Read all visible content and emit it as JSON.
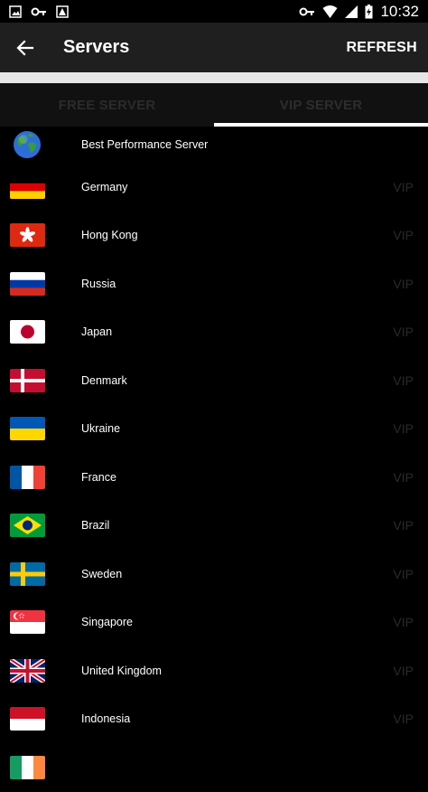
{
  "status_bar": {
    "time": "10:32"
  },
  "app_bar": {
    "title": "Servers",
    "refresh_label": "REFRESH"
  },
  "tabs": [
    {
      "label": "FREE SERVER",
      "active": false
    },
    {
      "label": "VIP SERVER",
      "active": true
    }
  ],
  "servers": [
    {
      "name": "Best Performance Server",
      "flag": "globe-icon",
      "badge": ""
    },
    {
      "name": "Germany",
      "flag": "germany-flag",
      "badge": "VIP"
    },
    {
      "name": "Hong Kong",
      "flag": "hong-kong-flag",
      "badge": "VIP"
    },
    {
      "name": "Russia",
      "flag": "russia-flag",
      "badge": "VIP"
    },
    {
      "name": "Japan",
      "flag": "japan-flag",
      "badge": "VIP"
    },
    {
      "name": "Denmark",
      "flag": "denmark-flag",
      "badge": "VIP"
    },
    {
      "name": "Ukraine",
      "flag": "ukraine-flag",
      "badge": "VIP"
    },
    {
      "name": "France",
      "flag": "france-flag",
      "badge": "VIP"
    },
    {
      "name": "Brazil",
      "flag": "brazil-flag",
      "badge": "VIP"
    },
    {
      "name": "Sweden",
      "flag": "sweden-flag",
      "badge": "VIP"
    },
    {
      "name": "Singapore",
      "flag": "singapore-flag",
      "badge": "VIP"
    },
    {
      "name": "United Kingdom",
      "flag": "united-kingdom-flag",
      "badge": "VIP"
    },
    {
      "name": "Indonesia",
      "flag": "indonesia-flag",
      "badge": "VIP"
    }
  ],
  "colors": {
    "app_bar": "#1f1f1f",
    "tab_bar": "#111111",
    "indicator": "#ffffff",
    "badge": "#2a2a2a"
  }
}
